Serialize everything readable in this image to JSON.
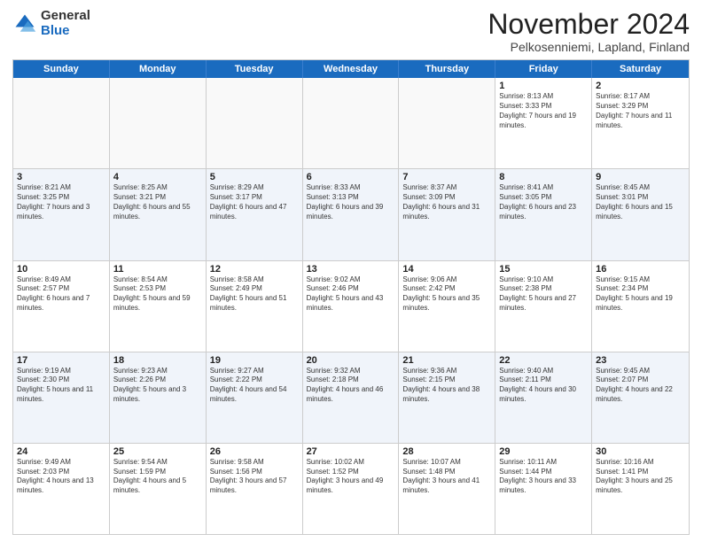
{
  "header": {
    "logo_general": "General",
    "logo_blue": "Blue",
    "month_title": "November 2024",
    "subtitle": "Pelkosenniemi, Lapland, Finland"
  },
  "weekdays": [
    "Sunday",
    "Monday",
    "Tuesday",
    "Wednesday",
    "Thursday",
    "Friday",
    "Saturday"
  ],
  "rows": [
    {
      "shade": false,
      "cells": [
        {
          "day": "",
          "text": ""
        },
        {
          "day": "",
          "text": ""
        },
        {
          "day": "",
          "text": ""
        },
        {
          "day": "",
          "text": ""
        },
        {
          "day": "",
          "text": ""
        },
        {
          "day": "1",
          "text": "Sunrise: 8:13 AM\nSunset: 3:33 PM\nDaylight: 7 hours and 19 minutes."
        },
        {
          "day": "2",
          "text": "Sunrise: 8:17 AM\nSunset: 3:29 PM\nDaylight: 7 hours and 11 minutes."
        }
      ]
    },
    {
      "shade": true,
      "cells": [
        {
          "day": "3",
          "text": "Sunrise: 8:21 AM\nSunset: 3:25 PM\nDaylight: 7 hours and 3 minutes."
        },
        {
          "day": "4",
          "text": "Sunrise: 8:25 AM\nSunset: 3:21 PM\nDaylight: 6 hours and 55 minutes."
        },
        {
          "day": "5",
          "text": "Sunrise: 8:29 AM\nSunset: 3:17 PM\nDaylight: 6 hours and 47 minutes."
        },
        {
          "day": "6",
          "text": "Sunrise: 8:33 AM\nSunset: 3:13 PM\nDaylight: 6 hours and 39 minutes."
        },
        {
          "day": "7",
          "text": "Sunrise: 8:37 AM\nSunset: 3:09 PM\nDaylight: 6 hours and 31 minutes."
        },
        {
          "day": "8",
          "text": "Sunrise: 8:41 AM\nSunset: 3:05 PM\nDaylight: 6 hours and 23 minutes."
        },
        {
          "day": "9",
          "text": "Sunrise: 8:45 AM\nSunset: 3:01 PM\nDaylight: 6 hours and 15 minutes."
        }
      ]
    },
    {
      "shade": false,
      "cells": [
        {
          "day": "10",
          "text": "Sunrise: 8:49 AM\nSunset: 2:57 PM\nDaylight: 6 hours and 7 minutes."
        },
        {
          "day": "11",
          "text": "Sunrise: 8:54 AM\nSunset: 2:53 PM\nDaylight: 5 hours and 59 minutes."
        },
        {
          "day": "12",
          "text": "Sunrise: 8:58 AM\nSunset: 2:49 PM\nDaylight: 5 hours and 51 minutes."
        },
        {
          "day": "13",
          "text": "Sunrise: 9:02 AM\nSunset: 2:46 PM\nDaylight: 5 hours and 43 minutes."
        },
        {
          "day": "14",
          "text": "Sunrise: 9:06 AM\nSunset: 2:42 PM\nDaylight: 5 hours and 35 minutes."
        },
        {
          "day": "15",
          "text": "Sunrise: 9:10 AM\nSunset: 2:38 PM\nDaylight: 5 hours and 27 minutes."
        },
        {
          "day": "16",
          "text": "Sunrise: 9:15 AM\nSunset: 2:34 PM\nDaylight: 5 hours and 19 minutes."
        }
      ]
    },
    {
      "shade": true,
      "cells": [
        {
          "day": "17",
          "text": "Sunrise: 9:19 AM\nSunset: 2:30 PM\nDaylight: 5 hours and 11 minutes."
        },
        {
          "day": "18",
          "text": "Sunrise: 9:23 AM\nSunset: 2:26 PM\nDaylight: 5 hours and 3 minutes."
        },
        {
          "day": "19",
          "text": "Sunrise: 9:27 AM\nSunset: 2:22 PM\nDaylight: 4 hours and 54 minutes."
        },
        {
          "day": "20",
          "text": "Sunrise: 9:32 AM\nSunset: 2:18 PM\nDaylight: 4 hours and 46 minutes."
        },
        {
          "day": "21",
          "text": "Sunrise: 9:36 AM\nSunset: 2:15 PM\nDaylight: 4 hours and 38 minutes."
        },
        {
          "day": "22",
          "text": "Sunrise: 9:40 AM\nSunset: 2:11 PM\nDaylight: 4 hours and 30 minutes."
        },
        {
          "day": "23",
          "text": "Sunrise: 9:45 AM\nSunset: 2:07 PM\nDaylight: 4 hours and 22 minutes."
        }
      ]
    },
    {
      "shade": false,
      "cells": [
        {
          "day": "24",
          "text": "Sunrise: 9:49 AM\nSunset: 2:03 PM\nDaylight: 4 hours and 13 minutes."
        },
        {
          "day": "25",
          "text": "Sunrise: 9:54 AM\nSunset: 1:59 PM\nDaylight: 4 hours and 5 minutes."
        },
        {
          "day": "26",
          "text": "Sunrise: 9:58 AM\nSunset: 1:56 PM\nDaylight: 3 hours and 57 minutes."
        },
        {
          "day": "27",
          "text": "Sunrise: 10:02 AM\nSunset: 1:52 PM\nDaylight: 3 hours and 49 minutes."
        },
        {
          "day": "28",
          "text": "Sunrise: 10:07 AM\nSunset: 1:48 PM\nDaylight: 3 hours and 41 minutes."
        },
        {
          "day": "29",
          "text": "Sunrise: 10:11 AM\nSunset: 1:44 PM\nDaylight: 3 hours and 33 minutes."
        },
        {
          "day": "30",
          "text": "Sunrise: 10:16 AM\nSunset: 1:41 PM\nDaylight: 3 hours and 25 minutes."
        }
      ]
    }
  ]
}
